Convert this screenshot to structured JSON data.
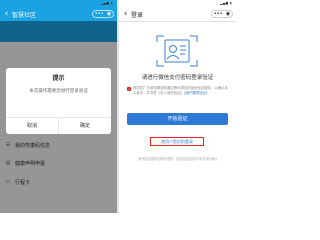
{
  "left_screen": {
    "status": {
      "time": "",
      "signal": "▂▄▆ ▮"
    },
    "nav": {
      "back_glyph": "‹",
      "title": "智慧社区",
      "more_glyph": "•••",
      "close_glyph": "◉"
    },
    "list_items": [
      {
        "label": "我的粤康码信息"
      },
      {
        "label": "健康声明申报"
      },
      {
        "label": "行程卡"
      }
    ],
    "dialog": {
      "title": "提示",
      "message": "本次操作需要您进行登录验证",
      "cancel_label": "取消",
      "confirm_label": "确定"
    }
  },
  "right_screen": {
    "status": {
      "time": "",
      "signal": "▂▄▆ ▮"
    },
    "nav": {
      "back_glyph": "‹",
      "title": "登录",
      "more_glyph": "•••",
      "close_glyph": "◉"
    },
    "heading": "请进行微信支付密码登录验证",
    "consent": {
      "text": "我同意广东政务服务网通过腾讯提供的身份验证服务，以确认本人身份，并同意《本人身份验证》",
      "link_text": "《用户服务协议》"
    },
    "start_button_label": "开始验证",
    "other_method_label": "使用人脸识别登录",
    "footer_note": "身份验证服务由腾讯提供，验证信息仅用于本次身份确认"
  },
  "colors": {
    "brand_blue": "#1aa2e3",
    "button_blue": "#2f79d6",
    "highlight_red": "#e2251f"
  }
}
